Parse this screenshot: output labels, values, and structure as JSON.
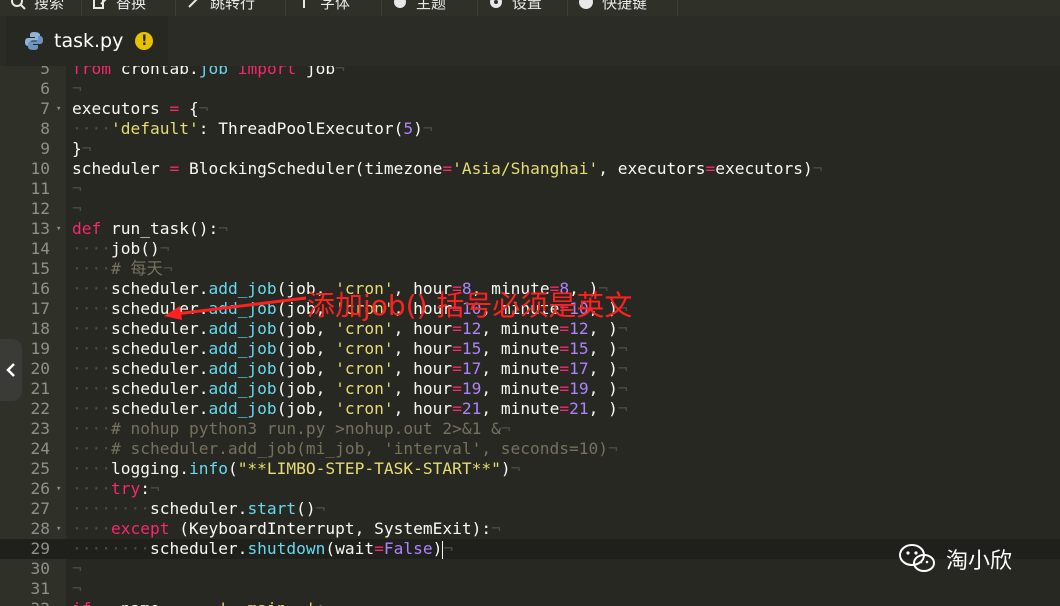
{
  "toolbar": {
    "buttons": [
      {
        "label": "搜索",
        "icon": "search-icon"
      },
      {
        "label": "替换",
        "icon": "replace-icon"
      },
      {
        "label": "跳转行",
        "icon": "goto-line-icon"
      },
      {
        "label": "字体",
        "icon": "font-icon"
      },
      {
        "label": "主题",
        "icon": "theme-icon"
      },
      {
        "label": "设置",
        "icon": "settings-icon"
      },
      {
        "label": "快捷键",
        "icon": "shortcut-info-icon"
      }
    ]
  },
  "tab": {
    "filename": "task.py",
    "file_icon": "python-icon",
    "status_icon": "unsaved-warning-icon",
    "status_symbol": "!",
    "status_color": "#e6c200"
  },
  "editor": {
    "theme_background": "#272822",
    "active_line": 29,
    "lines": [
      {
        "n": 5,
        "fold": false,
        "t": [
          [
            "kw",
            "from"
          ],
          [
            "p",
            " crontab."
          ],
          [
            "fn",
            "job"
          ],
          [
            "p",
            " "
          ],
          [
            "kw",
            "import"
          ],
          [
            "p",
            " job"
          ]
        ]
      },
      {
        "n": 6,
        "fold": false,
        "t": [
          [
            "p",
            ""
          ]
        ]
      },
      {
        "n": 7,
        "fold": true,
        "t": [
          [
            "p",
            "executors "
          ],
          [
            "kw",
            "="
          ],
          [
            "p",
            " {"
          ]
        ]
      },
      {
        "n": 8,
        "fold": false,
        "t": [
          [
            "inv",
            "····"
          ],
          [
            "st",
            "'default'"
          ],
          [
            "p",
            ": ThreadPoolExecutor("
          ],
          [
            "nm",
            "5"
          ],
          [
            "p",
            ")"
          ]
        ]
      },
      {
        "n": 9,
        "fold": false,
        "t": [
          [
            "p",
            "}"
          ]
        ]
      },
      {
        "n": 10,
        "fold": false,
        "t": [
          [
            "p",
            "scheduler "
          ],
          [
            "kw",
            "="
          ],
          [
            "p",
            " BlockingScheduler(timezone"
          ],
          [
            "kw",
            "="
          ],
          [
            "st",
            "'Asia/Shanghai'"
          ],
          [
            "p",
            ", executors"
          ],
          [
            "kw",
            "="
          ],
          [
            "p",
            "executors)"
          ]
        ]
      },
      {
        "n": 11,
        "fold": false,
        "t": [
          [
            "p",
            ""
          ]
        ]
      },
      {
        "n": 12,
        "fold": false,
        "t": [
          [
            "p",
            ""
          ]
        ]
      },
      {
        "n": 13,
        "fold": true,
        "t": [
          [
            "kw",
            "def"
          ],
          [
            "p",
            " run_task():"
          ]
        ]
      },
      {
        "n": 14,
        "fold": false,
        "t": [
          [
            "inv",
            "····"
          ],
          [
            "p",
            "job()"
          ]
        ]
      },
      {
        "n": 15,
        "fold": false,
        "t": [
          [
            "inv",
            "····"
          ],
          [
            "cm",
            "# 每天"
          ]
        ]
      },
      {
        "n": 16,
        "fold": false,
        "t": [
          [
            "inv",
            "····"
          ],
          [
            "p",
            "scheduler."
          ],
          [
            "fn",
            "add_job"
          ],
          [
            "p",
            "(job, "
          ],
          [
            "st",
            "'cron'"
          ],
          [
            "p",
            ", hour"
          ],
          [
            "kw",
            "="
          ],
          [
            "nm",
            "8"
          ],
          [
            "p",
            ", minute"
          ],
          [
            "kw",
            "="
          ],
          [
            "nm",
            "8"
          ],
          [
            "p",
            ", )"
          ]
        ]
      },
      {
        "n": 17,
        "fold": false,
        "t": [
          [
            "inv",
            "····"
          ],
          [
            "p",
            "scheduler."
          ],
          [
            "fn",
            "add_job"
          ],
          [
            "p",
            "(job, "
          ],
          [
            "st",
            "'cron'"
          ],
          [
            "p",
            ", hour"
          ],
          [
            "kw",
            "="
          ],
          [
            "nm",
            "10"
          ],
          [
            "p",
            ", minute"
          ],
          [
            "kw",
            "="
          ],
          [
            "nm",
            "10"
          ],
          [
            "p",
            ", )"
          ]
        ]
      },
      {
        "n": 18,
        "fold": false,
        "t": [
          [
            "inv",
            "····"
          ],
          [
            "p",
            "scheduler."
          ],
          [
            "fn",
            "add_job"
          ],
          [
            "p",
            "(job, "
          ],
          [
            "st",
            "'cron'"
          ],
          [
            "p",
            ", hour"
          ],
          [
            "kw",
            "="
          ],
          [
            "nm",
            "12"
          ],
          [
            "p",
            ", minute"
          ],
          [
            "kw",
            "="
          ],
          [
            "nm",
            "12"
          ],
          [
            "p",
            ", )"
          ]
        ]
      },
      {
        "n": 19,
        "fold": false,
        "t": [
          [
            "inv",
            "····"
          ],
          [
            "p",
            "scheduler."
          ],
          [
            "fn",
            "add_job"
          ],
          [
            "p",
            "(job, "
          ],
          [
            "st",
            "'cron'"
          ],
          [
            "p",
            ", hour"
          ],
          [
            "kw",
            "="
          ],
          [
            "nm",
            "15"
          ],
          [
            "p",
            ", minute"
          ],
          [
            "kw",
            "="
          ],
          [
            "nm",
            "15"
          ],
          [
            "p",
            ", )"
          ]
        ]
      },
      {
        "n": 20,
        "fold": false,
        "t": [
          [
            "inv",
            "····"
          ],
          [
            "p",
            "scheduler."
          ],
          [
            "fn",
            "add_job"
          ],
          [
            "p",
            "(job, "
          ],
          [
            "st",
            "'cron'"
          ],
          [
            "p",
            ", hour"
          ],
          [
            "kw",
            "="
          ],
          [
            "nm",
            "17"
          ],
          [
            "p",
            ", minute"
          ],
          [
            "kw",
            "="
          ],
          [
            "nm",
            "17"
          ],
          [
            "p",
            ", )"
          ]
        ]
      },
      {
        "n": 21,
        "fold": false,
        "t": [
          [
            "inv",
            "····"
          ],
          [
            "p",
            "scheduler."
          ],
          [
            "fn",
            "add_job"
          ],
          [
            "p",
            "(job, "
          ],
          [
            "st",
            "'cron'"
          ],
          [
            "p",
            ", hour"
          ],
          [
            "kw",
            "="
          ],
          [
            "nm",
            "19"
          ],
          [
            "p",
            ", minute"
          ],
          [
            "kw",
            "="
          ],
          [
            "nm",
            "19"
          ],
          [
            "p",
            ", )"
          ]
        ]
      },
      {
        "n": 22,
        "fold": false,
        "t": [
          [
            "inv",
            "····"
          ],
          [
            "p",
            "scheduler."
          ],
          [
            "fn",
            "add_job"
          ],
          [
            "p",
            "(job, "
          ],
          [
            "st",
            "'cron'"
          ],
          [
            "p",
            ", hour"
          ],
          [
            "kw",
            "="
          ],
          [
            "nm",
            "21"
          ],
          [
            "p",
            ", minute"
          ],
          [
            "kw",
            "="
          ],
          [
            "nm",
            "21"
          ],
          [
            "p",
            ", )"
          ]
        ]
      },
      {
        "n": 23,
        "fold": false,
        "t": [
          [
            "inv",
            "····"
          ],
          [
            "cm",
            "# nohup python3 run.py >nohup.out 2>&1 &"
          ]
        ]
      },
      {
        "n": 24,
        "fold": false,
        "t": [
          [
            "inv",
            "····"
          ],
          [
            "cm",
            "# scheduler.add_job(mi_job, 'interval', seconds=10)"
          ]
        ]
      },
      {
        "n": 25,
        "fold": false,
        "t": [
          [
            "inv",
            "····"
          ],
          [
            "p",
            "logging."
          ],
          [
            "fn",
            "info"
          ],
          [
            "p",
            "("
          ],
          [
            "st",
            "\"**LIMBO-STEP-TASK-START**\""
          ],
          [
            "p",
            ")"
          ]
        ]
      },
      {
        "n": 26,
        "fold": true,
        "t": [
          [
            "inv",
            "····"
          ],
          [
            "kw",
            "try"
          ],
          [
            "p",
            ":"
          ]
        ]
      },
      {
        "n": 27,
        "fold": false,
        "t": [
          [
            "inv",
            "········"
          ],
          [
            "p",
            "scheduler."
          ],
          [
            "fn",
            "start"
          ],
          [
            "p",
            "()"
          ]
        ]
      },
      {
        "n": 28,
        "fold": true,
        "t": [
          [
            "inv",
            "····"
          ],
          [
            "kw",
            "except"
          ],
          [
            "p",
            " (KeyboardInterrupt, SystemExit):"
          ]
        ]
      },
      {
        "n": 29,
        "fold": false,
        "t": [
          [
            "inv",
            "········"
          ],
          [
            "p",
            "scheduler."
          ],
          [
            "fn",
            "shutdown"
          ],
          [
            "p",
            "(wait"
          ],
          [
            "kw",
            "="
          ],
          [
            "nm",
            "False"
          ],
          [
            "p",
            ")"
          ]
        ]
      },
      {
        "n": 30,
        "fold": false,
        "t": [
          [
            "p",
            ""
          ]
        ]
      },
      {
        "n": 31,
        "fold": false,
        "t": [
          [
            "p",
            ""
          ]
        ]
      },
      {
        "n": 32,
        "fold": true,
        "t": [
          [
            "kw",
            "if"
          ],
          [
            "p",
            " __name__ "
          ],
          [
            "kw",
            "=="
          ],
          [
            "p",
            " "
          ],
          [
            "st",
            "'__main__'"
          ],
          [
            "p",
            ":"
          ]
        ]
      }
    ]
  },
  "annotation": {
    "text": "添加job() 括号必须是英文",
    "color": "#ff2020"
  },
  "watermark": {
    "text": "淘小欣",
    "icon": "wechat-icon"
  }
}
